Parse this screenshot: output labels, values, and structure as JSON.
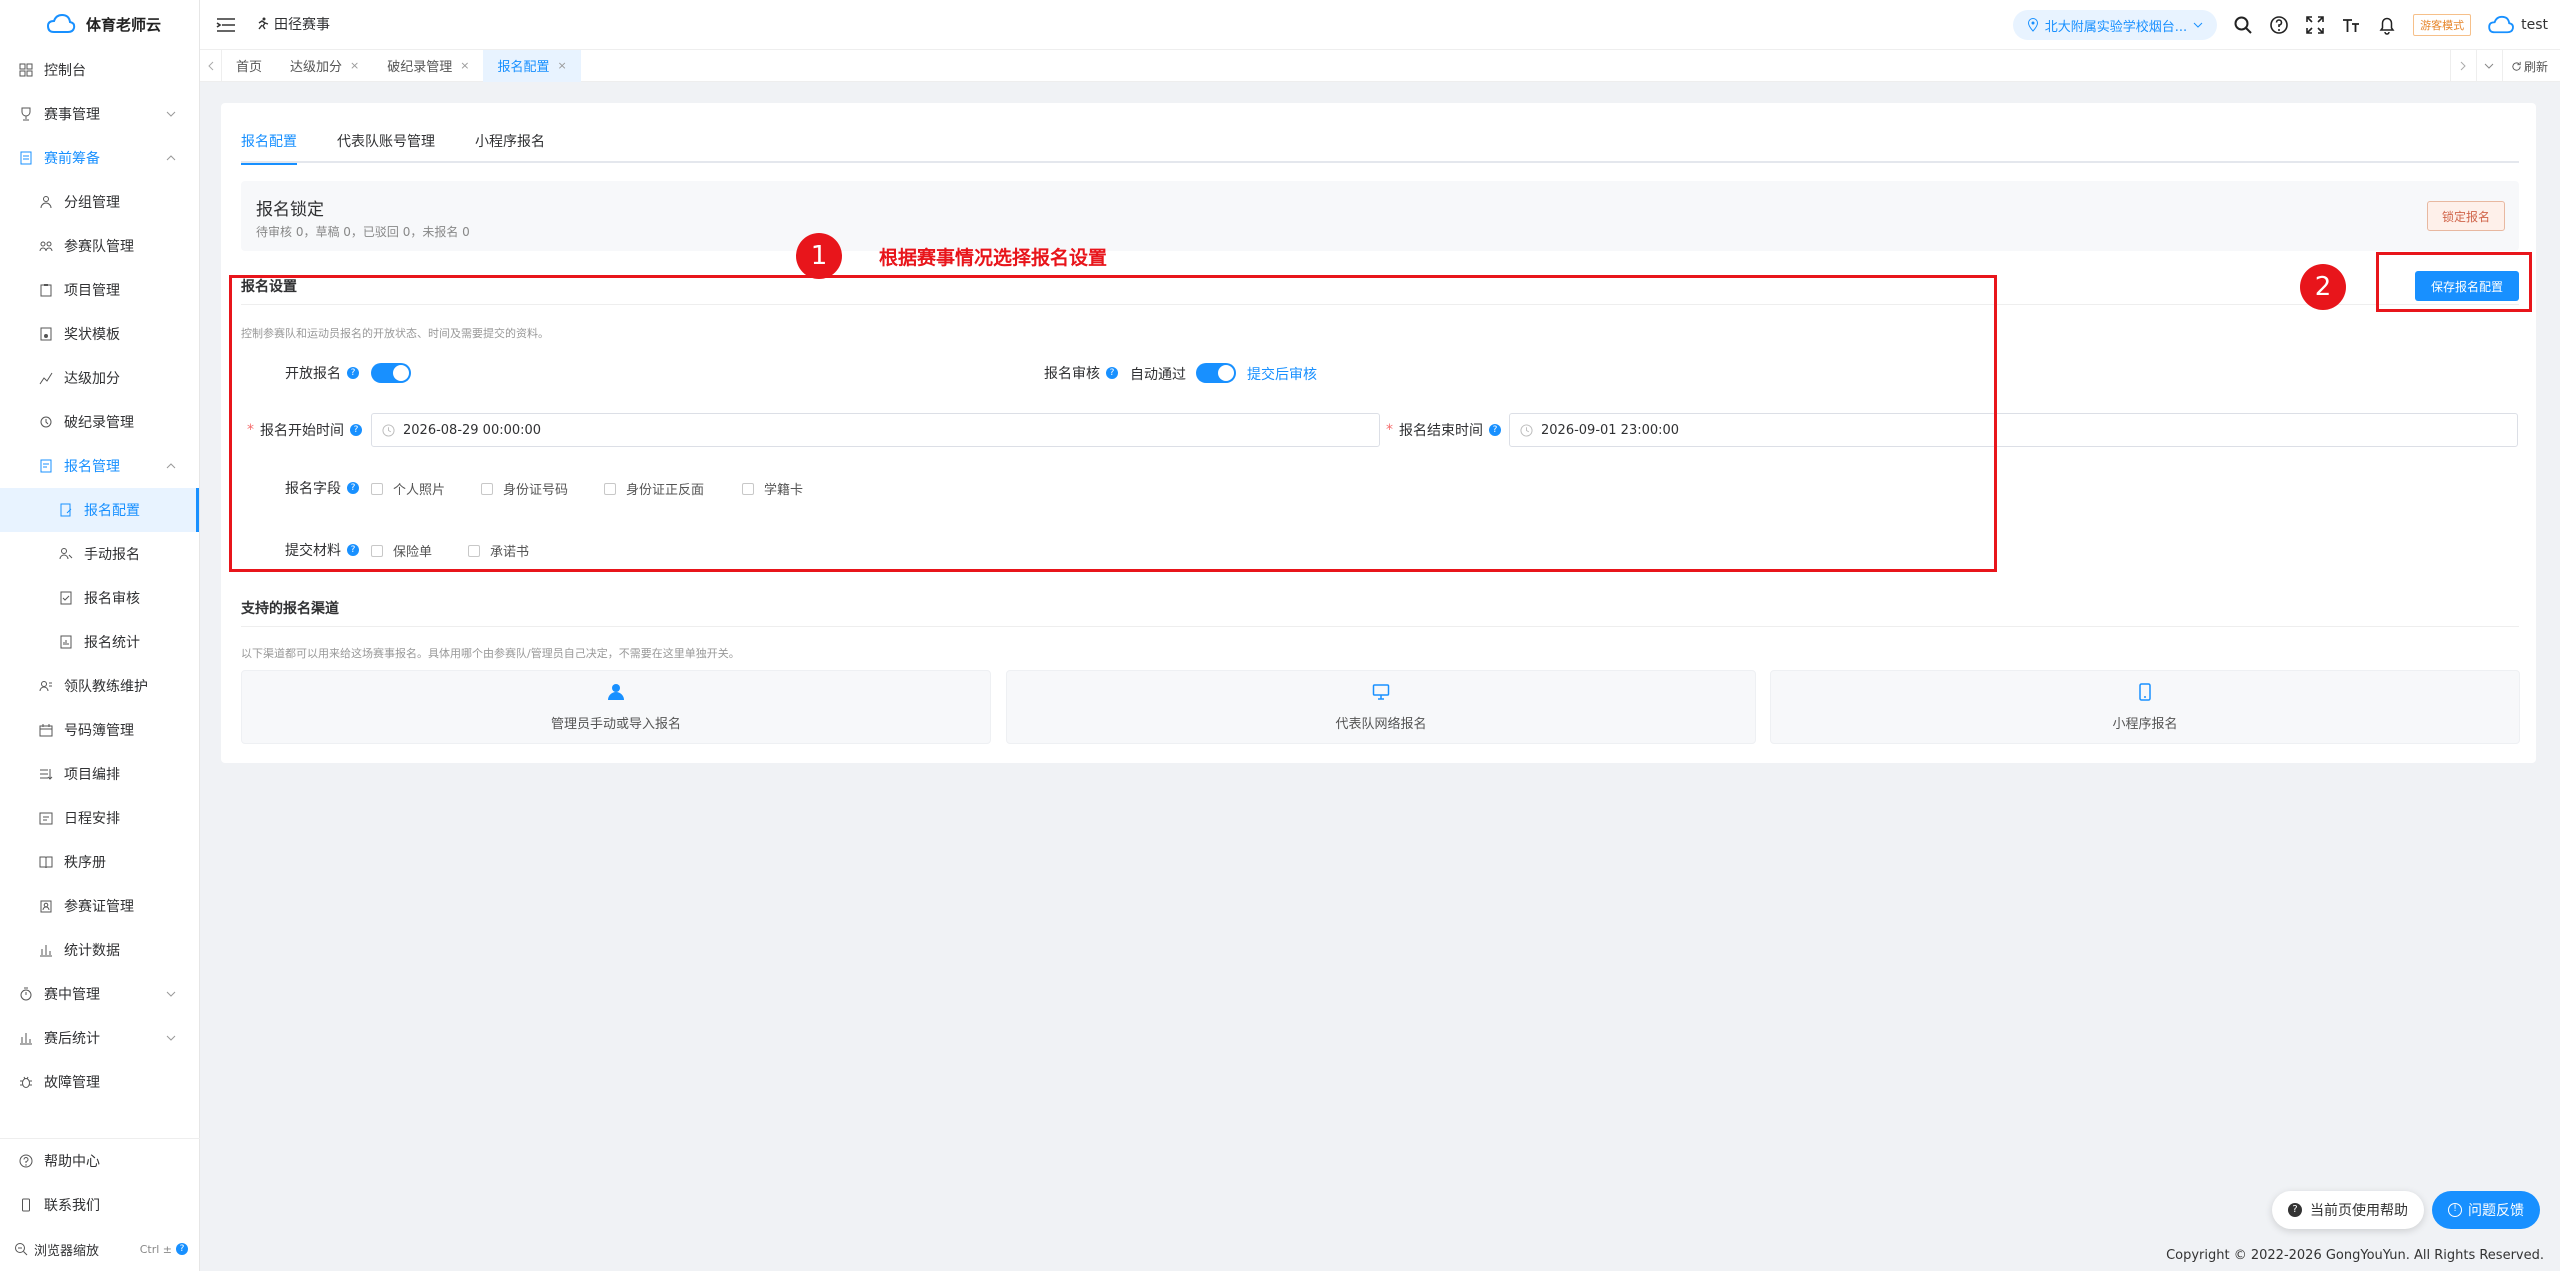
{
  "brand": {
    "name": "体育老师云"
  },
  "sidebar": {
    "items": [
      {
        "label": "控制台"
      },
      {
        "label": "赛事管理"
      },
      {
        "label": "赛前筹备"
      },
      {
        "label": "分组管理"
      },
      {
        "label": "参赛队管理"
      },
      {
        "label": "项目管理"
      },
      {
        "label": "奖状模板"
      },
      {
        "label": "达级加分"
      },
      {
        "label": "破纪录管理"
      },
      {
        "label": "报名管理"
      },
      {
        "label": "报名配置"
      },
      {
        "label": "手动报名"
      },
      {
        "label": "报名审核"
      },
      {
        "label": "报名统计"
      },
      {
        "label": "领队教练维护"
      },
      {
        "label": "号码簿管理"
      },
      {
        "label": "项目编排"
      },
      {
        "label": "日程安排"
      },
      {
        "label": "秩序册"
      },
      {
        "label": "参赛证管理"
      },
      {
        "label": "统计数据"
      },
      {
        "label": "赛中管理"
      },
      {
        "label": "赛后统计"
      },
      {
        "label": "故障管理"
      }
    ],
    "bottom": [
      {
        "label": "帮助中心"
      },
      {
        "label": "联系我们"
      }
    ],
    "zoom": {
      "label": "浏览器缩放",
      "shortcut": "Ctrl ±"
    }
  },
  "header": {
    "title": "田径赛事",
    "school": "北大附属实验学校烟台...",
    "mode": "游客模式",
    "user": "test"
  },
  "tabs": [
    {
      "label": "首页"
    },
    {
      "label": "达级加分"
    },
    {
      "label": "破纪录管理"
    },
    {
      "label": "报名配置"
    }
  ],
  "tabs_refresh": "刷新",
  "subtabs": [
    {
      "label": "报名配置"
    },
    {
      "label": "代表队账号管理"
    },
    {
      "label": "小程序报名"
    }
  ],
  "lock": {
    "title": "报名锁定",
    "stats": "待审核 0，草稿 0，已驳回 0，未报名 0",
    "button": "锁定报名"
  },
  "settings": {
    "title": "报名设置",
    "desc": "控制参赛队和运动员报名的开放状态、时间及需要提交的资料。",
    "save_button": "保存报名配置",
    "open_label": "开放报名",
    "open_on": true,
    "review_label": "报名审核",
    "review_auto": "自动通过",
    "review_on": true,
    "review_after": "提交后审核",
    "start_label": "报名开始时间",
    "start_value": "2026-08-29 00:00:00",
    "end_label": "报名结束时间",
    "end_value": "2026-09-01 23:00:00",
    "fields_label": "报名字段",
    "fields": [
      {
        "label": "个人照片"
      },
      {
        "label": "身份证号码"
      },
      {
        "label": "身份证正反面"
      },
      {
        "label": "学籍卡"
      }
    ],
    "materials_label": "提交材料",
    "materials": [
      {
        "label": "保险单"
      },
      {
        "label": "承诺书"
      }
    ]
  },
  "channels": {
    "title": "支持的报名渠道",
    "desc": "以下渠道都可以用来给这场赛事报名。具体用哪个由参赛队/管理员自己决定，不需要在这里单独开关。",
    "items": [
      {
        "label": "管理员手动或导入报名",
        "icon": "user-icon"
      },
      {
        "label": "代表队网络报名",
        "icon": "monitor-icon"
      },
      {
        "label": "小程序报名",
        "icon": "phone-icon"
      }
    ]
  },
  "annotations": {
    "one": "1",
    "one_text": "根据赛事情况选择报名设置",
    "two": "2"
  },
  "float": {
    "help": "当前页使用帮助",
    "feedback": "问题反馈"
  },
  "footer": {
    "copyright": "Copyright © 2022-2026 GongYouYun. All Rights Reserved."
  },
  "colors": {
    "primary": "#1890ff",
    "annotation": "#e8151b"
  }
}
